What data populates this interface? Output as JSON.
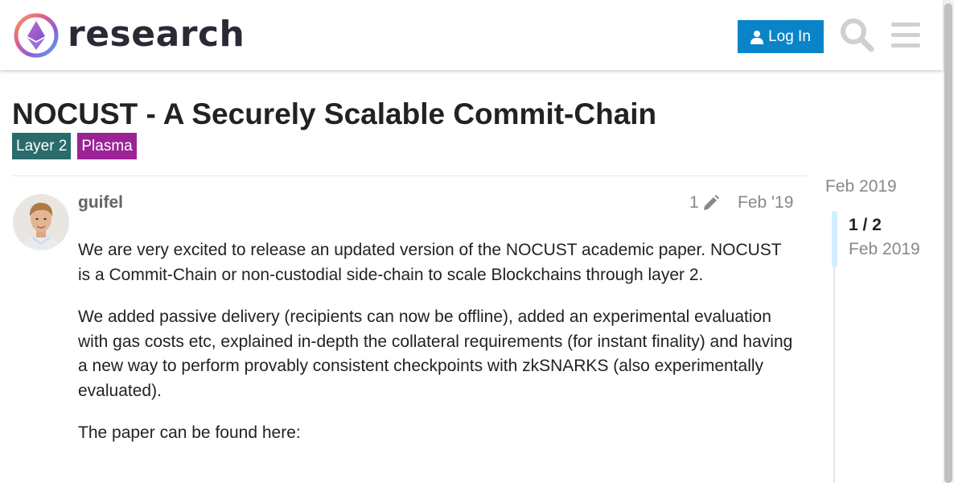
{
  "header": {
    "brand": "research",
    "login_label": "Log In",
    "icons": {
      "logo": "ethereum-research-logo",
      "user": "user-icon",
      "search": "search-icon",
      "menu": "hamburger-menu-icon"
    },
    "login_color": "#0a84c8"
  },
  "topic": {
    "title": "NOCUST - A Securely Scalable Commit-Chain",
    "tags": [
      {
        "label": "Layer 2",
        "color": "#2a6b6b"
      },
      {
        "label": "Plasma",
        "color": "#9b2396"
      }
    ]
  },
  "post": {
    "username": "guifel",
    "edit_count": "1",
    "edit_icon": "pencil-icon",
    "date": "Feb '19",
    "paragraphs": [
      "We are very excited to release an updated version of the NOCUST academic paper. NOCUST is a Commit-Chain or non-custodial side-chain to scale Blockchains through layer 2.",
      "We added passive delivery (recipients can now be offline), added an experimental evaluation with gas costs etc, explained in-depth the collateral requirements (for instant finality) and having a new way to perform provably consistent checkpoints with zkSNARKS (also experimentally evaluated).",
      "The paper can be found here:"
    ]
  },
  "timeline": {
    "start_date": "Feb 2019",
    "position": "1 / 2",
    "position_date": "Feb 2019"
  }
}
